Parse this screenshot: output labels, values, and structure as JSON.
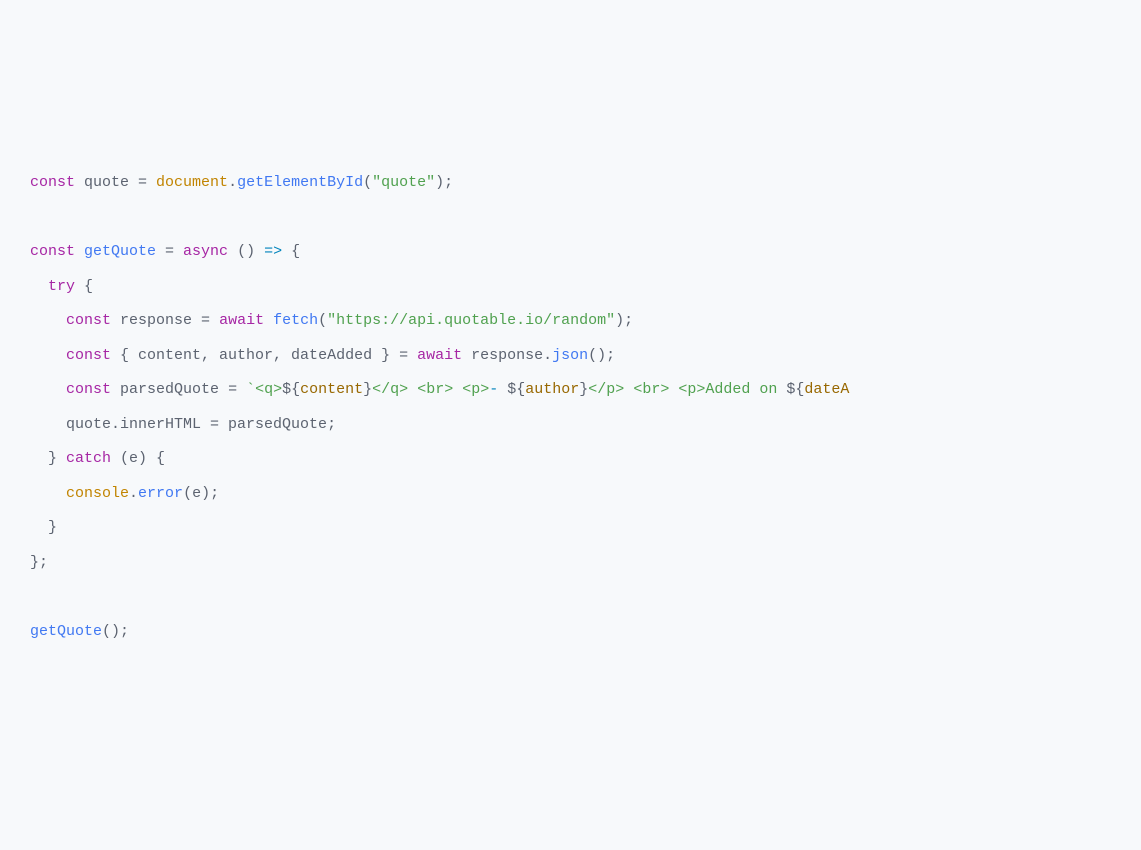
{
  "code": {
    "lines": [
      [
        {
          "t": "const ",
          "c": "kw"
        },
        {
          "t": "quote ",
          "c": "id"
        },
        {
          "t": "= ",
          "c": "punc"
        },
        {
          "t": "document",
          "c": "glob"
        },
        {
          "t": ".",
          "c": "punc"
        },
        {
          "t": "getElementById",
          "c": "fn"
        },
        {
          "t": "(",
          "c": "punc"
        },
        {
          "t": "\"quote\"",
          "c": "str"
        },
        {
          "t": ");",
          "c": "punc"
        }
      ],
      [],
      [
        {
          "t": "const ",
          "c": "kw"
        },
        {
          "t": "getQuote ",
          "c": "fn"
        },
        {
          "t": "= ",
          "c": "punc"
        },
        {
          "t": "async ",
          "c": "kw"
        },
        {
          "t": "() ",
          "c": "punc"
        },
        {
          "t": "=>",
          "c": "op"
        },
        {
          "t": " {",
          "c": "punc"
        }
      ],
      [
        {
          "t": "  ",
          "c": "id"
        },
        {
          "t": "try ",
          "c": "kw"
        },
        {
          "t": "{",
          "c": "punc"
        }
      ],
      [
        {
          "t": "    ",
          "c": "id"
        },
        {
          "t": "const ",
          "c": "kw"
        },
        {
          "t": "response ",
          "c": "id"
        },
        {
          "t": "= ",
          "c": "punc"
        },
        {
          "t": "await ",
          "c": "kw"
        },
        {
          "t": "fetch",
          "c": "fn"
        },
        {
          "t": "(",
          "c": "punc"
        },
        {
          "t": "\"https://api.quotable.io/random\"",
          "c": "str"
        },
        {
          "t": ");",
          "c": "punc"
        }
      ],
      [
        {
          "t": "    ",
          "c": "id"
        },
        {
          "t": "const ",
          "c": "kw"
        },
        {
          "t": "{ content, author, dateAdded } ",
          "c": "id"
        },
        {
          "t": "= ",
          "c": "punc"
        },
        {
          "t": "await ",
          "c": "kw"
        },
        {
          "t": "response.",
          "c": "id"
        },
        {
          "t": "json",
          "c": "fn"
        },
        {
          "t": "();",
          "c": "punc"
        }
      ],
      [
        {
          "t": "    ",
          "c": "id"
        },
        {
          "t": "const ",
          "c": "kw"
        },
        {
          "t": "parsedQuote ",
          "c": "id"
        },
        {
          "t": "= ",
          "c": "punc"
        },
        {
          "t": "`",
          "c": "str"
        },
        {
          "t": "<q>",
          "c": "tag"
        },
        {
          "t": "${",
          "c": "punc"
        },
        {
          "t": "content",
          "c": "attr"
        },
        {
          "t": "}",
          "c": "punc"
        },
        {
          "t": "</q>",
          "c": "tag"
        },
        {
          "t": " ",
          "c": "str"
        },
        {
          "t": "<br>",
          "c": "tag"
        },
        {
          "t": " ",
          "c": "str"
        },
        {
          "t": "<p>",
          "c": "tag"
        },
        {
          "t": "- ",
          "c": "op"
        },
        {
          "t": "${",
          "c": "punc"
        },
        {
          "t": "author",
          "c": "attr"
        },
        {
          "t": "}",
          "c": "punc"
        },
        {
          "t": "</p>",
          "c": "tag"
        },
        {
          "t": " ",
          "c": "str"
        },
        {
          "t": "<br>",
          "c": "tag"
        },
        {
          "t": " ",
          "c": "str"
        },
        {
          "t": "<p>",
          "c": "tag"
        },
        {
          "t": "Added on ",
          "c": "str"
        },
        {
          "t": "${",
          "c": "punc"
        },
        {
          "t": "dateA",
          "c": "attr"
        }
      ],
      [
        {
          "t": "    quote.innerHTML ",
          "c": "id"
        },
        {
          "t": "= ",
          "c": "punc"
        },
        {
          "t": "parsedQuote;",
          "c": "id"
        }
      ],
      [
        {
          "t": "  } ",
          "c": "punc"
        },
        {
          "t": "catch ",
          "c": "kw"
        },
        {
          "t": "(e) {",
          "c": "punc"
        }
      ],
      [
        {
          "t": "    ",
          "c": "id"
        },
        {
          "t": "console",
          "c": "glob"
        },
        {
          "t": ".",
          "c": "punc"
        },
        {
          "t": "error",
          "c": "fn"
        },
        {
          "t": "(e);",
          "c": "punc"
        }
      ],
      [
        {
          "t": "  }",
          "c": "punc"
        }
      ],
      [
        {
          "t": "};",
          "c": "punc"
        }
      ],
      [],
      [
        {
          "t": "getQuote",
          "c": "fn"
        },
        {
          "t": "();",
          "c": "punc"
        }
      ]
    ]
  }
}
